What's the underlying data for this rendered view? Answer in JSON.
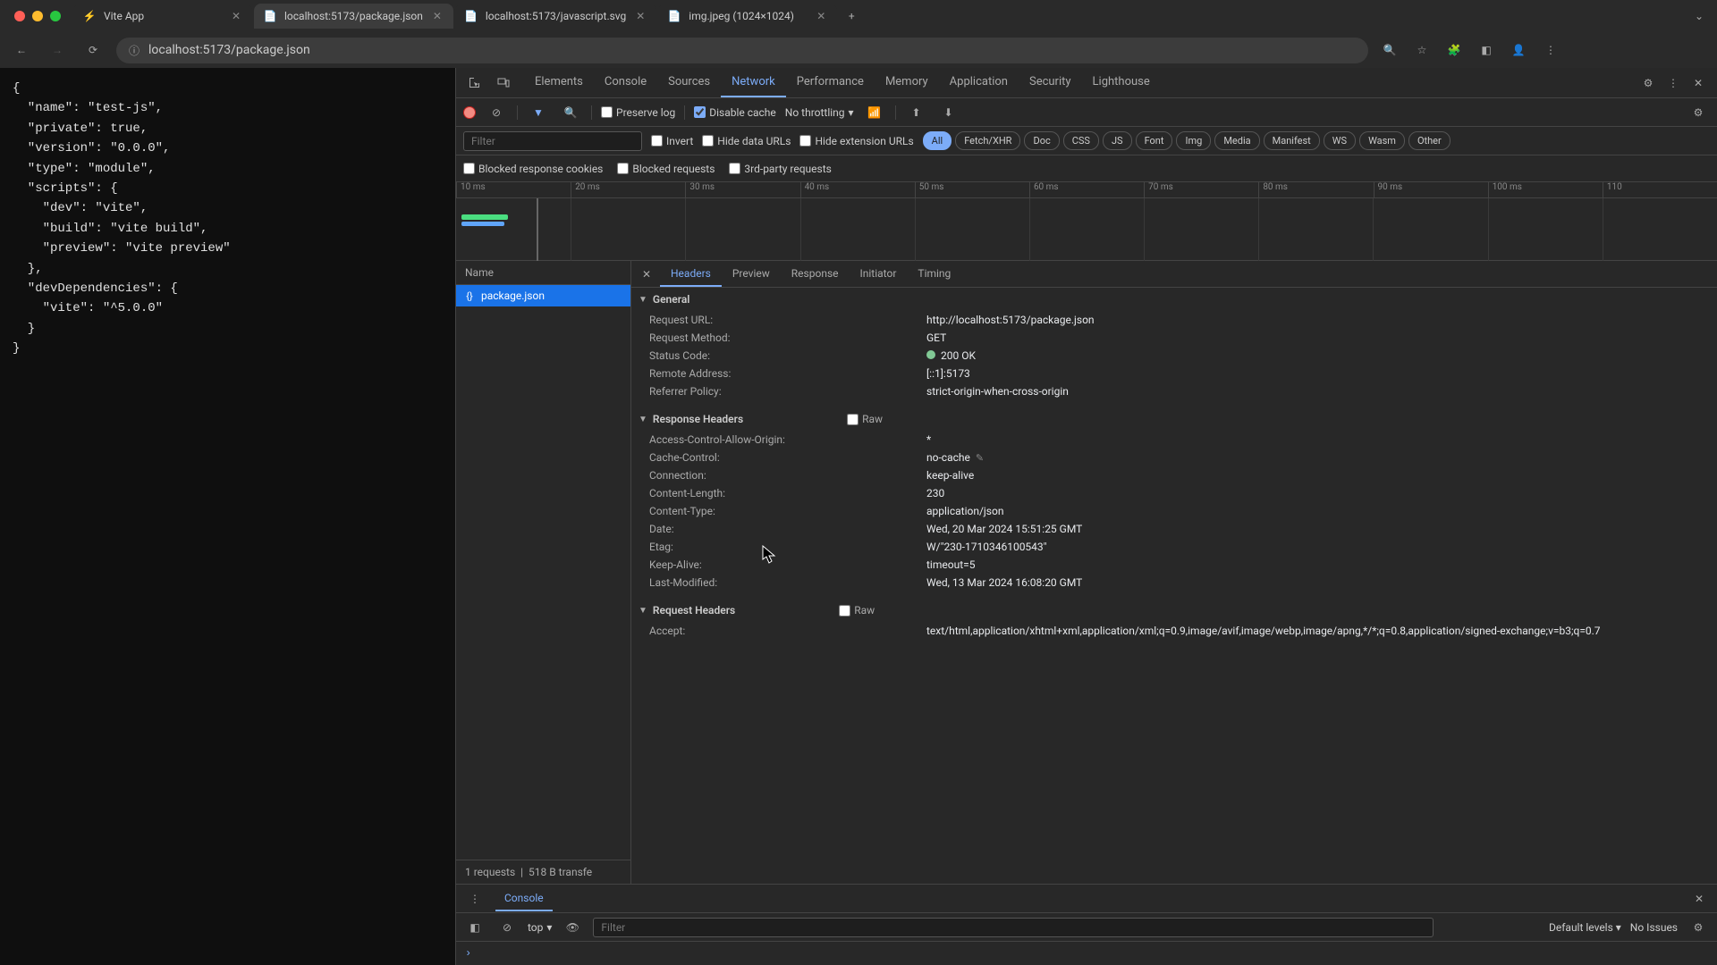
{
  "browser": {
    "tabs": [
      {
        "title": "Vite App",
        "favicon": "⚡"
      },
      {
        "title": "localhost:5173/package.json",
        "favicon": "📄"
      },
      {
        "title": "localhost:5173/javascript.svg",
        "favicon": "📄"
      },
      {
        "title": "img.jpeg (1024×1024)",
        "favicon": "📄"
      }
    ],
    "url": "localhost:5173/package.json"
  },
  "page_content": "{\n  \"name\": \"test-js\",\n  \"private\": true,\n  \"version\": \"0.0.0\",\n  \"type\": \"module\",\n  \"scripts\": {\n    \"dev\": \"vite\",\n    \"build\": \"vite build\",\n    \"preview\": \"vite preview\"\n  },\n  \"devDependencies\": {\n    \"vite\": \"^5.0.0\"\n  }\n}",
  "devtools": {
    "panels": [
      "Elements",
      "Console",
      "Sources",
      "Network",
      "Performance",
      "Memory",
      "Application",
      "Security",
      "Lighthouse"
    ],
    "active_panel": "Network",
    "network_toolbar": {
      "preserve_log": "Preserve log",
      "disable_cache": "Disable cache",
      "throttling": "No throttling"
    },
    "filter_placeholder": "Filter",
    "filter_checks": {
      "invert": "Invert",
      "hide_data": "Hide data URLs",
      "hide_ext": "Hide extension URLs"
    },
    "type_filters": [
      "All",
      "Fetch/XHR",
      "Doc",
      "CSS",
      "JS",
      "Font",
      "Img",
      "Media",
      "Manifest",
      "WS",
      "Wasm",
      "Other"
    ],
    "filter_checks2": {
      "blocked_cookies": "Blocked response cookies",
      "blocked_req": "Blocked requests",
      "third_party": "3rd-party requests"
    },
    "timeline_ticks": [
      "10 ms",
      "20 ms",
      "30 ms",
      "40 ms",
      "50 ms",
      "60 ms",
      "70 ms",
      "80 ms",
      "90 ms",
      "100 ms",
      "110"
    ],
    "request_list": {
      "header": "Name",
      "rows": [
        {
          "name": "package.json"
        }
      ],
      "footer_requests": "1 requests",
      "footer_transfer": "518 B transfe"
    },
    "detail_tabs": [
      "Headers",
      "Preview",
      "Response",
      "Initiator",
      "Timing"
    ],
    "active_detail_tab": "Headers",
    "sections": {
      "general": {
        "title": "General",
        "rows": [
          {
            "k": "Request URL:",
            "v": "http://localhost:5173/package.json"
          },
          {
            "k": "Request Method:",
            "v": "GET"
          },
          {
            "k": "Status Code:",
            "v": "200 OK",
            "status": true
          },
          {
            "k": "Remote Address:",
            "v": "[::1]:5173"
          },
          {
            "k": "Referrer Policy:",
            "v": "strict-origin-when-cross-origin"
          }
        ]
      },
      "response_headers": {
        "title": "Response Headers",
        "raw_label": "Raw",
        "rows": [
          {
            "k": "Access-Control-Allow-Origin:",
            "v": "*"
          },
          {
            "k": "Cache-Control:",
            "v": "no-cache",
            "editable": true
          },
          {
            "k": "Connection:",
            "v": "keep-alive"
          },
          {
            "k": "Content-Length:",
            "v": "230"
          },
          {
            "k": "Content-Type:",
            "v": "application/json"
          },
          {
            "k": "Date:",
            "v": "Wed, 20 Mar 2024 15:51:25 GMT"
          },
          {
            "k": "Etag:",
            "v": "W/\"230-1710346100543\""
          },
          {
            "k": "Keep-Alive:",
            "v": "timeout=5"
          },
          {
            "k": "Last-Modified:",
            "v": "Wed, 13 Mar 2024 16:08:20 GMT"
          }
        ]
      },
      "request_headers": {
        "title": "Request Headers",
        "raw_label": "Raw",
        "rows": [
          {
            "k": "Accept:",
            "v": "text/html,application/xhtml+xml,application/xml;q=0.9,image/avif,image/webp,image/apng,*/*;q=0.8,application/signed-exchange;v=b3;q=0.7"
          }
        ]
      }
    }
  },
  "console_drawer": {
    "tab_label": "Console",
    "context": "top",
    "filter_placeholder": "Filter",
    "levels": "Default levels",
    "issues": "No Issues",
    "prompt": "›"
  }
}
